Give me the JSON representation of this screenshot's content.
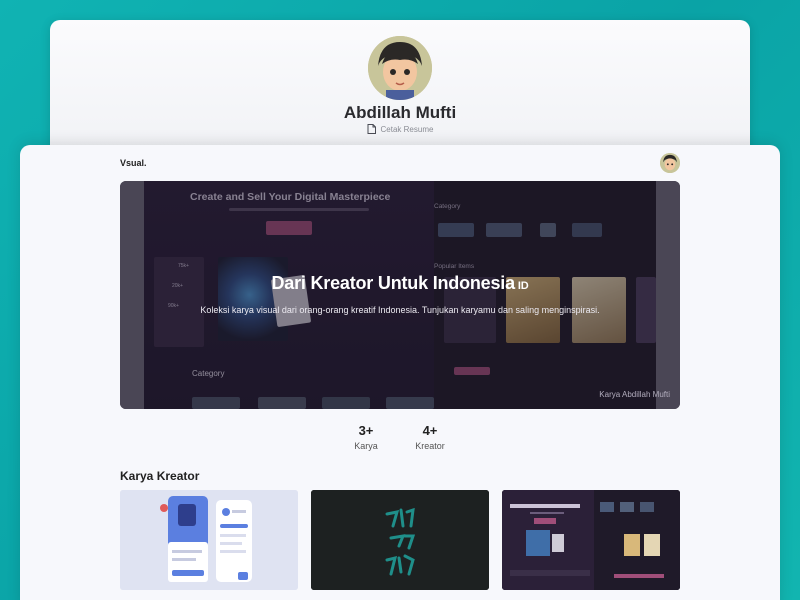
{
  "profile": {
    "name": "Abdillah Mufti",
    "resume_label": "Cetak Resume"
  },
  "nav": {
    "brand": "Vsual."
  },
  "hero": {
    "title": "Dari Kreator Untuk Indonesia",
    "title_tag": "ID",
    "description": "Koleksi karya visual dari orang-orang kreatif Indonesia. Tunjukan karyamu dan saling menginspirasi.",
    "credit": "Karya Abdillah Mufti",
    "preview": {
      "headline": "Create and Sell Your Digital Masterpiece",
      "category_right": "Category",
      "popular": "Popular Items",
      "category_bottom": "Category",
      "stats": [
        "75k+",
        "20k+",
        "90k+"
      ]
    }
  },
  "stats": [
    {
      "value": "3+",
      "label": "Karya"
    },
    {
      "value": "4+",
      "label": "Kreator"
    }
  ],
  "section": {
    "title": "Karya Kreator"
  },
  "colors": {
    "background": "#10b3b3",
    "hero_accent": "#a04e79",
    "dark_panel": "#1f1a29"
  }
}
